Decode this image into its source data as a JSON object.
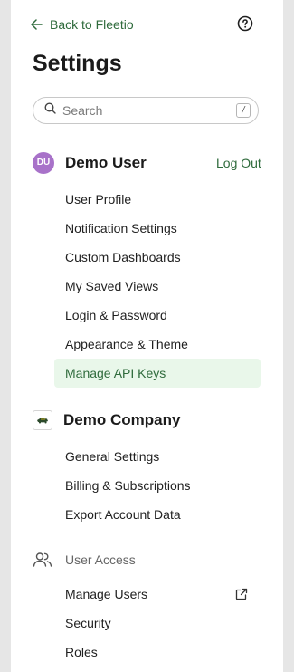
{
  "header": {
    "back_label": "Back to Fleetio",
    "title": "Settings"
  },
  "search": {
    "placeholder": "Search",
    "value": "",
    "shortcut": "/"
  },
  "user_section": {
    "avatar_initials": "DU",
    "name": "Demo User",
    "logout_label": "Log Out",
    "items": [
      {
        "label": "User Profile"
      },
      {
        "label": "Notification Settings"
      },
      {
        "label": "Custom Dashboards"
      },
      {
        "label": "My Saved Views"
      },
      {
        "label": "Login & Password"
      },
      {
        "label": "Appearance & Theme"
      },
      {
        "label": "Manage API Keys",
        "active": true
      }
    ]
  },
  "company_section": {
    "name": "Demo Company",
    "items": [
      {
        "label": "General Settings"
      },
      {
        "label": "Billing & Subscriptions"
      },
      {
        "label": "Export Account Data"
      }
    ]
  },
  "user_access_section": {
    "title": "User Access",
    "items": [
      {
        "label": "Manage Users",
        "external": true
      },
      {
        "label": "Security"
      },
      {
        "label": "Roles"
      }
    ]
  },
  "colors": {
    "accent": "#2f6b3c",
    "active_bg": "#e9f7ea",
    "avatar_bg": "#a872c9"
  },
  "icons": {
    "back": "arrow-left-icon",
    "help": "question-circle-icon",
    "search": "magnifier-icon",
    "user_access": "users-icon",
    "external": "external-link-icon"
  }
}
